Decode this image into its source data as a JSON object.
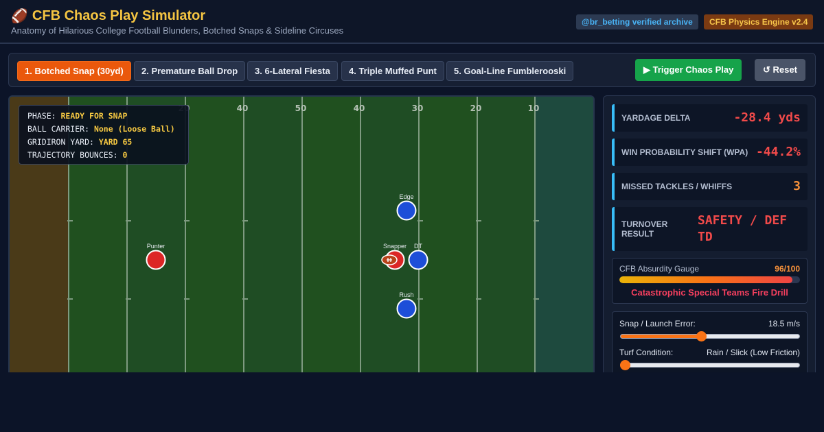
{
  "header": {
    "icon": "football-icon",
    "title": "CFB Chaos Play Simulator",
    "subtitle": "Anatomy of Hilarious College Football Blunders, Botched Snaps & Sideline Circuses",
    "badge_handle": "@br_betting verified archive",
    "badge_engine": "CFB Physics Engine v2.4"
  },
  "toolbar": {
    "tabs": [
      {
        "label": "1. Botched Snap (30yd)",
        "active": true
      },
      {
        "label": "2. Premature Ball Drop",
        "active": false
      },
      {
        "label": "3. 6-Lateral Fiesta",
        "active": false
      },
      {
        "label": "4. Triple Muffed Punt",
        "active": false
      },
      {
        "label": "5. Goal-Line Fumblerooski",
        "active": false
      }
    ],
    "trigger_label": "▶ Trigger Chaos Play",
    "reset_label": "↺ Reset"
  },
  "hud": {
    "phase_label": "PHASE:",
    "phase_value": "READY FOR SNAP",
    "carrier_label": "BALL CARRIER:",
    "carrier_value": "None (Loose Ball)",
    "yard_label": "GRIDIRON YARD:",
    "yard_value": "YARD 65",
    "bounces_label": "TRAJECTORY BOUNCES:",
    "bounces_value": "0"
  },
  "field": {
    "yard_numbers": [
      "20",
      "40",
      "50",
      "40",
      "30",
      "20",
      "10"
    ],
    "players": [
      {
        "label": "Punter",
        "team": "offense"
      },
      {
        "label": "Snapper",
        "team": "offense"
      },
      {
        "label": "DT",
        "team": "defense"
      },
      {
        "label": "Edge",
        "team": "defense"
      },
      {
        "label": "Rush",
        "team": "defense"
      }
    ],
    "colors": {
      "offense": "#dc2626",
      "defense": "#1d4ed8",
      "turf": "#1f4d24",
      "endzone_left": "#4a3a18",
      "endzone_right": "#1e4a3e"
    }
  },
  "stats": {
    "yardage_label": "YARDAGE DELTA",
    "yardage_value": "-28.4 yds",
    "wpa_label": "WIN PROBABILITY SHIFT (WPA)",
    "wpa_value": "-44.2%",
    "tackles_label": "MISSED TACKLES / WHIFFS",
    "tackles_value": "3",
    "turnover_label": "TURNOVER RESULT",
    "turnover_value": "SAFETY / DEF TD"
  },
  "gauge": {
    "label": "CFB Absurdity Gauge",
    "score": "96/100",
    "level": 0.96,
    "verdict": "Catastrophic Special Teams Fire Drill"
  },
  "controls": {
    "snap_label": "Snap / Launch Error:",
    "snap_value": "18.5 m/s",
    "snap_level": 0.45,
    "turf_label": "Turf Condition:",
    "turf_value": "Rain / Slick (Low Friction)",
    "turf_level": 0.0
  }
}
